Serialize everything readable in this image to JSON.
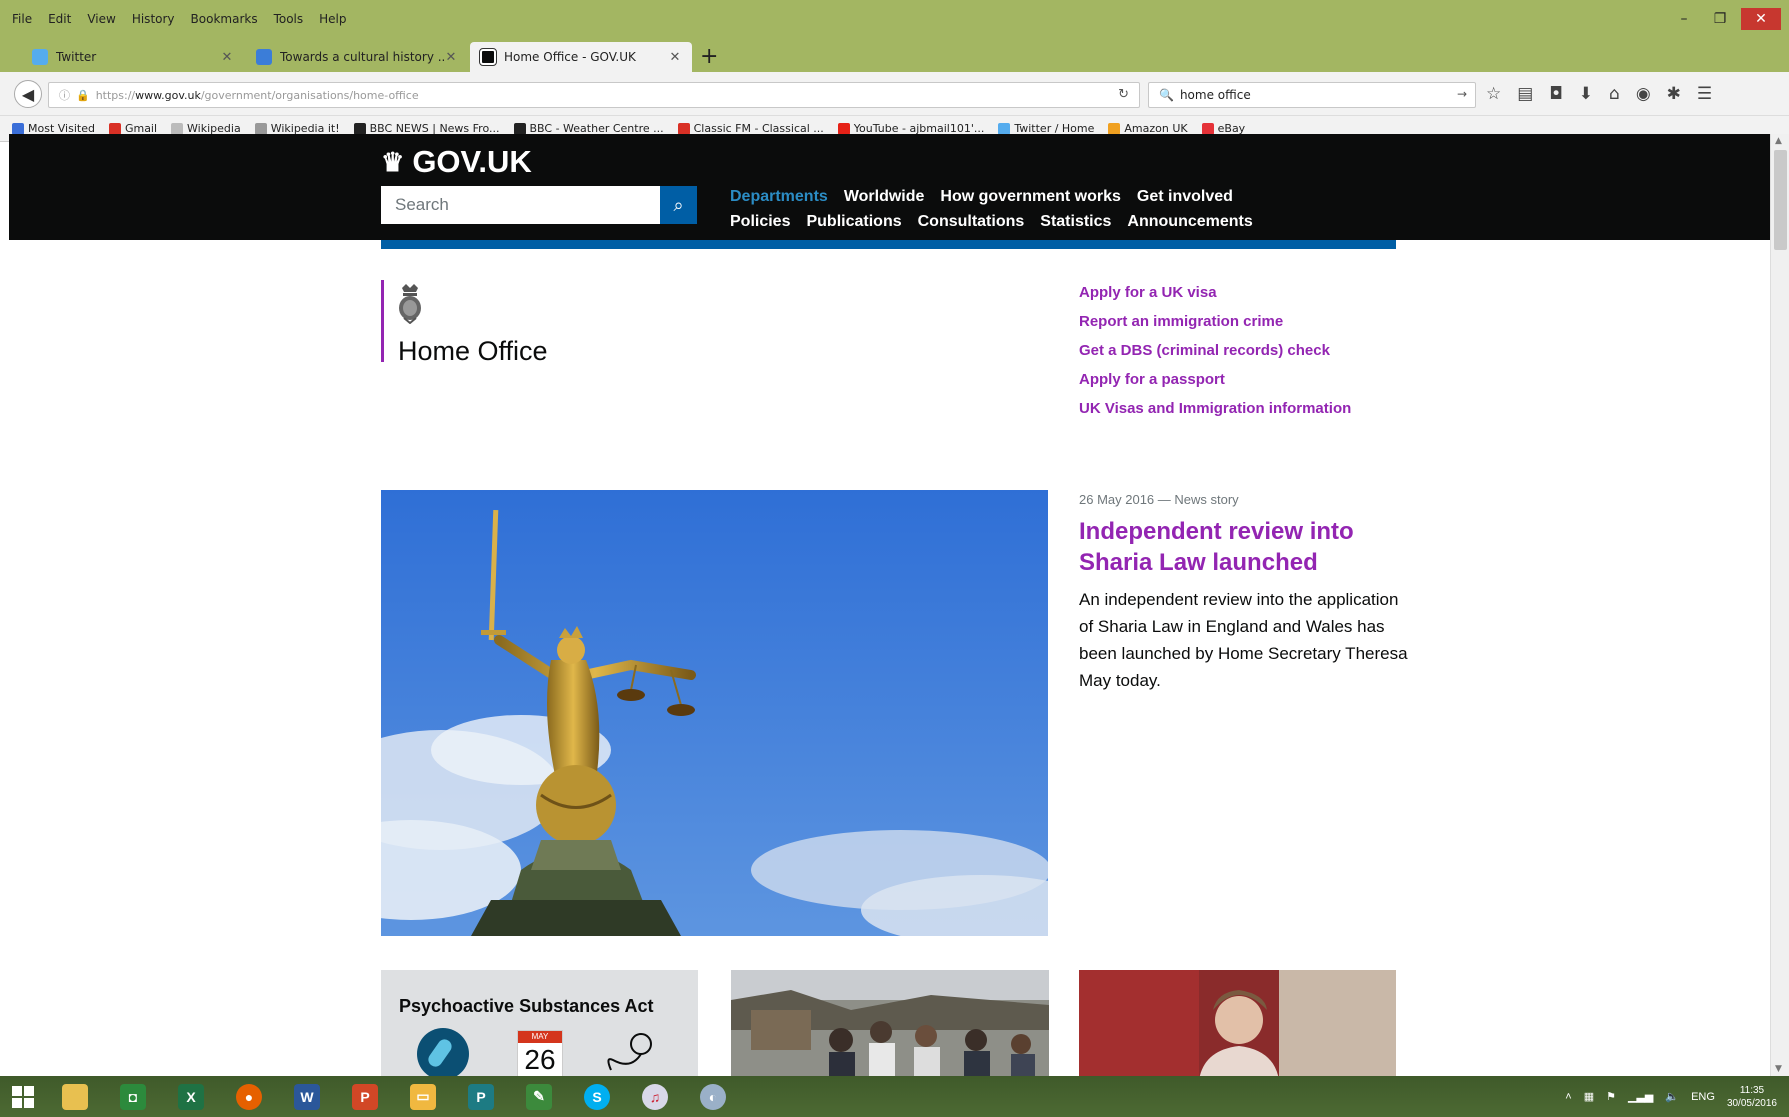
{
  "browser": {
    "menu": [
      "File",
      "Edit",
      "View",
      "History",
      "Bookmarks",
      "Tools",
      "Help"
    ],
    "tabs": [
      {
        "label": "Twitter",
        "icon": "twitter-icon",
        "color": "#55acee"
      },
      {
        "label": "Towards a cultural history ...",
        "icon": "document-icon",
        "color": "#3b7dd8"
      },
      {
        "label": "Home Office - GOV.UK",
        "icon": "govuk-icon",
        "color": "#0b0c0c"
      }
    ],
    "url": {
      "prefix": "https://",
      "domain": "www.gov.uk",
      "path": "/government/organisations/home-office"
    },
    "search_value": "home office",
    "bookmarks": [
      {
        "label": "Most Visited",
        "color": "#3a6ed8"
      },
      {
        "label": "Gmail",
        "color": "#d93025"
      },
      {
        "label": "Wikipedia",
        "color": "#666666"
      },
      {
        "label": "Wikipedia it!",
        "color": "#666666"
      },
      {
        "label": "BBC NEWS | News Fro...",
        "color": "#222222"
      },
      {
        "label": "BBC - Weather Centre ...",
        "color": "#222222"
      },
      {
        "label": "Classic FM - Classical ...",
        "color": "#d93025"
      },
      {
        "label": "YouTube - ajbmail101'...",
        "color": "#e62117"
      },
      {
        "label": "Twitter / Home",
        "color": "#55acee"
      },
      {
        "label": "Amazon UK",
        "color": "#f0a020"
      },
      {
        "label": "eBay",
        "color": "#e53238"
      }
    ]
  },
  "govuk": {
    "logo": "GOV.UK",
    "search_placeholder": "Search",
    "nav_row1": [
      "Departments",
      "Worldwide",
      "How government works",
      "Get involved"
    ],
    "nav_row2": [
      "Policies",
      "Publications",
      "Consultations",
      "Statistics",
      "Announcements"
    ],
    "org_name": "Home Office",
    "quick_links": [
      "Apply for a UK visa",
      "Report an immigration crime",
      "Get a DBS (criminal records) check",
      "Apply for a passport",
      "UK Visas and Immigration information"
    ],
    "story": {
      "meta": "26 May 2016 — News story",
      "title": "Independent review into Sharia Law launched",
      "description": "An independent review into the application of Sharia Law in England and Wales has been launched by Home Secretary Theresa May today."
    },
    "cards": {
      "card1_title": "Psychoactive Substances Act",
      "cal_month": "MAY",
      "cal_day": "26"
    }
  },
  "taskbar": {
    "language": "ENG",
    "time": "11:35",
    "date": "30/05/2016"
  },
  "colors": {
    "govuk_black": "#0b0c0c",
    "govuk_blue": "#005ea5",
    "link_purple": "#9325b2",
    "chrome_green": "#a3b662"
  }
}
